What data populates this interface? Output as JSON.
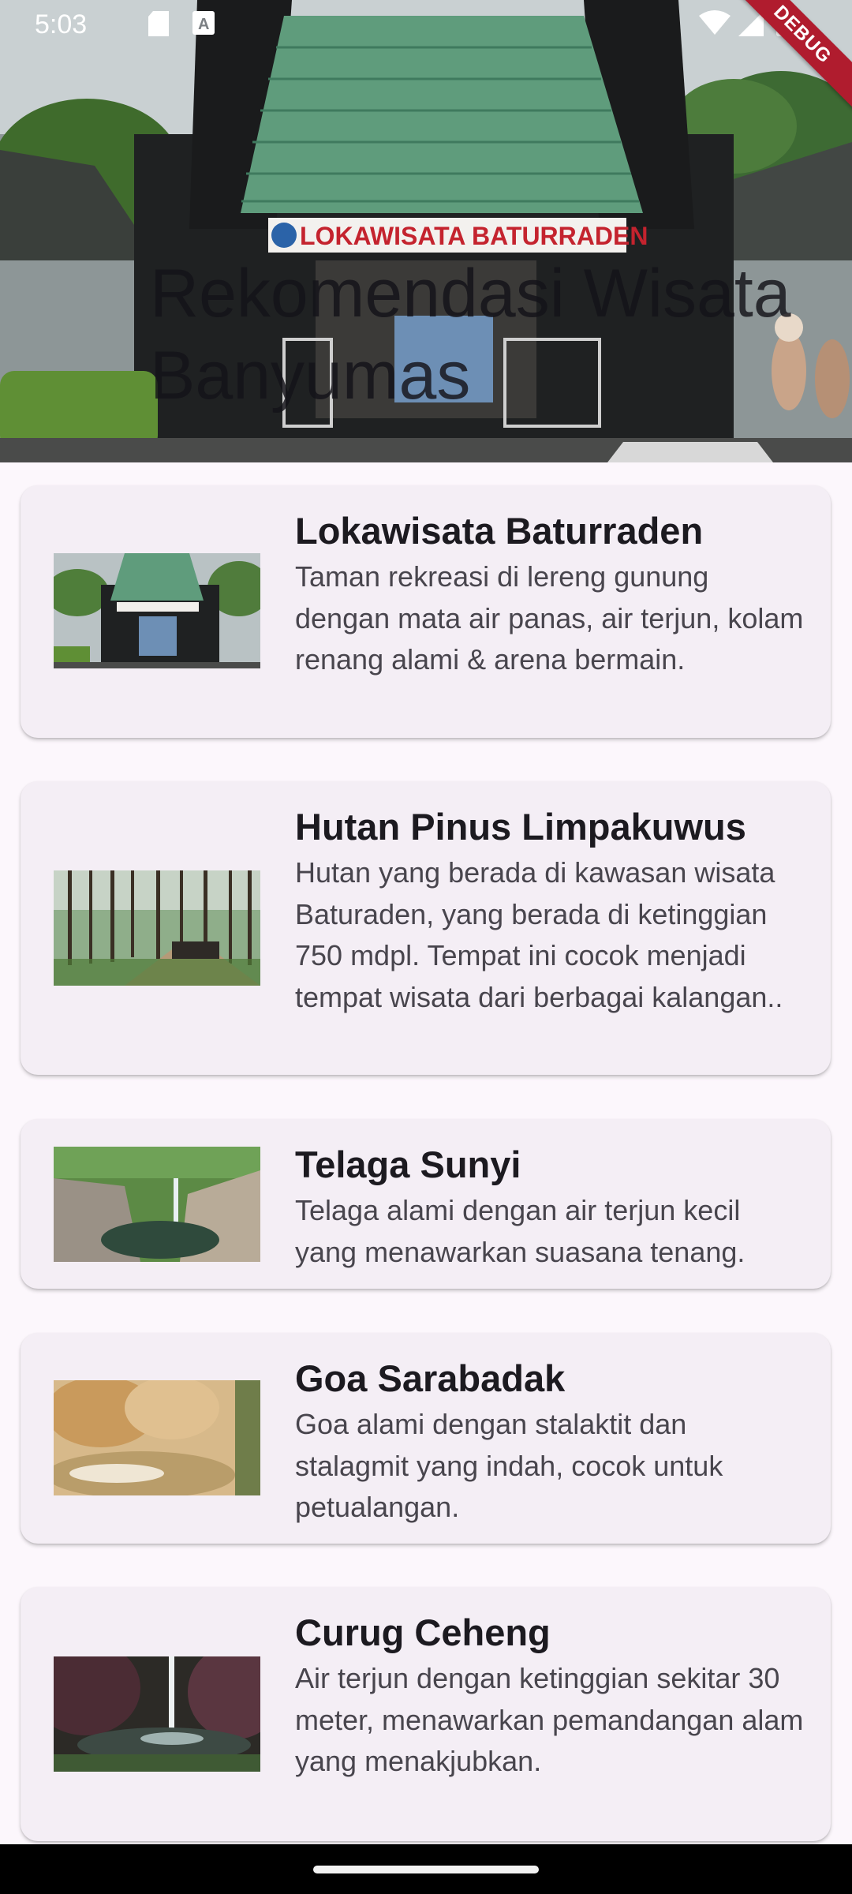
{
  "status_bar": {
    "time": "5:03",
    "icons": [
      "sd-card-icon",
      "text-a-icon",
      "wifi-icon",
      "signal-icon",
      "battery-icon"
    ],
    "debug_label": "DEBUG"
  },
  "header": {
    "title": "Rekomendasi Wisata Banyumas",
    "image_sign_text": "LOKAWISATA BATURRADEN"
  },
  "places": [
    {
      "name": "Lokawisata Baturraden",
      "description": "Taman rekreasi di lereng gunung dengan mata air panas, air terjun, kolam renang alami & arena bermain."
    },
    {
      "name": "Hutan Pinus Limpakuwus",
      "description": "Hutan yang berada di kawasan wisata Baturaden, yang berada di ketinggian 750 mdpl. Tempat ini cocok menjadi tempat wisata dari berbagai kalangan.."
    },
    {
      "name": "Telaga Sunyi",
      "description": "Telaga alami dengan air terjun kecil yang menawarkan suasana tenang."
    },
    {
      "name": "Goa Sarabadak",
      "description": "Goa alami dengan stalaktit dan stalagmit yang indah, cocok untuk petualangan."
    },
    {
      "name": "Curug Ceheng",
      "description": "Air terjun dengan ketinggian sekitar 30 meter, menawarkan pemandangan alam yang menakjubkan."
    }
  ],
  "colors": {
    "background": "#fcf7fc",
    "card": "#f4eef5",
    "title_text": "#1c1a20",
    "body_text": "#48454d",
    "debug_banner": "#b01c2e"
  }
}
